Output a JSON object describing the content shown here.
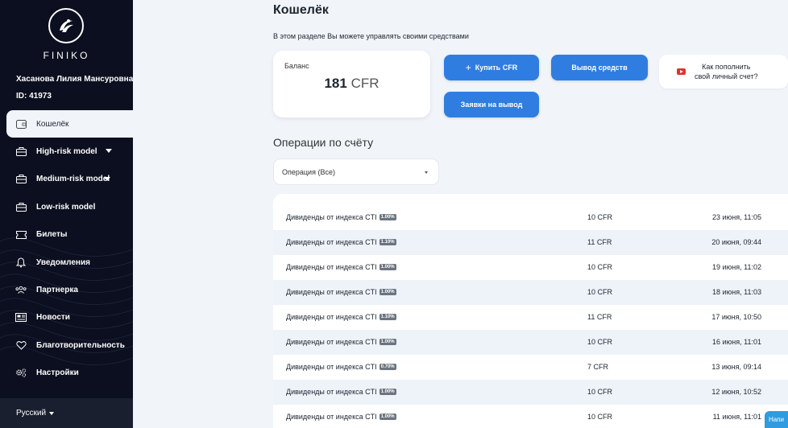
{
  "sidebar": {
    "brand": "FINIKO",
    "user_name": "Хасанова Лилия Мансуровна",
    "user_id": "ID: 41973",
    "items": [
      {
        "label": "Кошелёк",
        "icon": "wallet-icon"
      },
      {
        "label": "High-risk model",
        "icon": "briefcase-icon"
      },
      {
        "label": "Medium-risk model",
        "icon": "briefcase-icon"
      },
      {
        "label": "Low-risk model",
        "icon": "briefcase-icon"
      },
      {
        "label": "Билеты",
        "icon": "ticket-icon"
      },
      {
        "label": "Уведомления",
        "icon": "bell-icon"
      },
      {
        "label": "Партнерка",
        "icon": "users-icon"
      },
      {
        "label": "Новости",
        "icon": "newspaper-icon"
      },
      {
        "label": "Благотворительность",
        "icon": "heart-icon"
      },
      {
        "label": "Настройки",
        "icon": "gears-icon"
      }
    ],
    "language": "Русский"
  },
  "main": {
    "title": "Кошелёк",
    "description": "В этом разделе Вы можете управлять своими средствами",
    "balance": {
      "label": "Баланс",
      "amount": "181",
      "currency": "CFR"
    },
    "buttons": {
      "buy": "Купить CFR",
      "withdraw": "Вывод средств",
      "requests": "Заявки на вывод"
    },
    "help": {
      "line1": "Как пополнить",
      "line2": "свой личный счет?"
    },
    "operations_title": "Операции по счёту",
    "filter": {
      "selected": "Операция (Все)"
    },
    "operations": [
      {
        "desc": "Дивиденды от индекса CTI",
        "badge": "1.00%",
        "amount": "10 CFR",
        "date": "23 июня, 11:05"
      },
      {
        "desc": "Дивиденды от индекса CTI",
        "badge": "1.10%",
        "amount": "11 CFR",
        "date": "20 июня, 09:44"
      },
      {
        "desc": "Дивиденды от индекса CTI",
        "badge": "1.00%",
        "amount": "10 CFR",
        "date": "19 июня, 11:02"
      },
      {
        "desc": "Дивиденды от индекса CTI",
        "badge": "1.00%",
        "amount": "10 CFR",
        "date": "18 июня, 11:03"
      },
      {
        "desc": "Дивиденды от индекса CTI",
        "badge": "1.10%",
        "amount": "11 CFR",
        "date": "17 июня, 10:50"
      },
      {
        "desc": "Дивиденды от индекса CTI",
        "badge": "1.00%",
        "amount": "10 CFR",
        "date": "16 июня, 11:01"
      },
      {
        "desc": "Дивиденды от индекса CTI",
        "badge": "0.70%",
        "amount": "7 CFR",
        "date": "13 июня, 09:14"
      },
      {
        "desc": "Дивиденды от индекса CTI",
        "badge": "1.00%",
        "amount": "10 CFR",
        "date": "12 июня, 10:52"
      },
      {
        "desc": "Дивиденды от индекса CTI",
        "badge": "1.00%",
        "amount": "10 CFR",
        "date": "11 июня, 11:01"
      }
    ],
    "corner_button": "Напи"
  },
  "colors": {
    "accent": "#2f7de1",
    "sidebar_bg": "#0b0f1f",
    "page_bg": "#f1f5fa"
  }
}
